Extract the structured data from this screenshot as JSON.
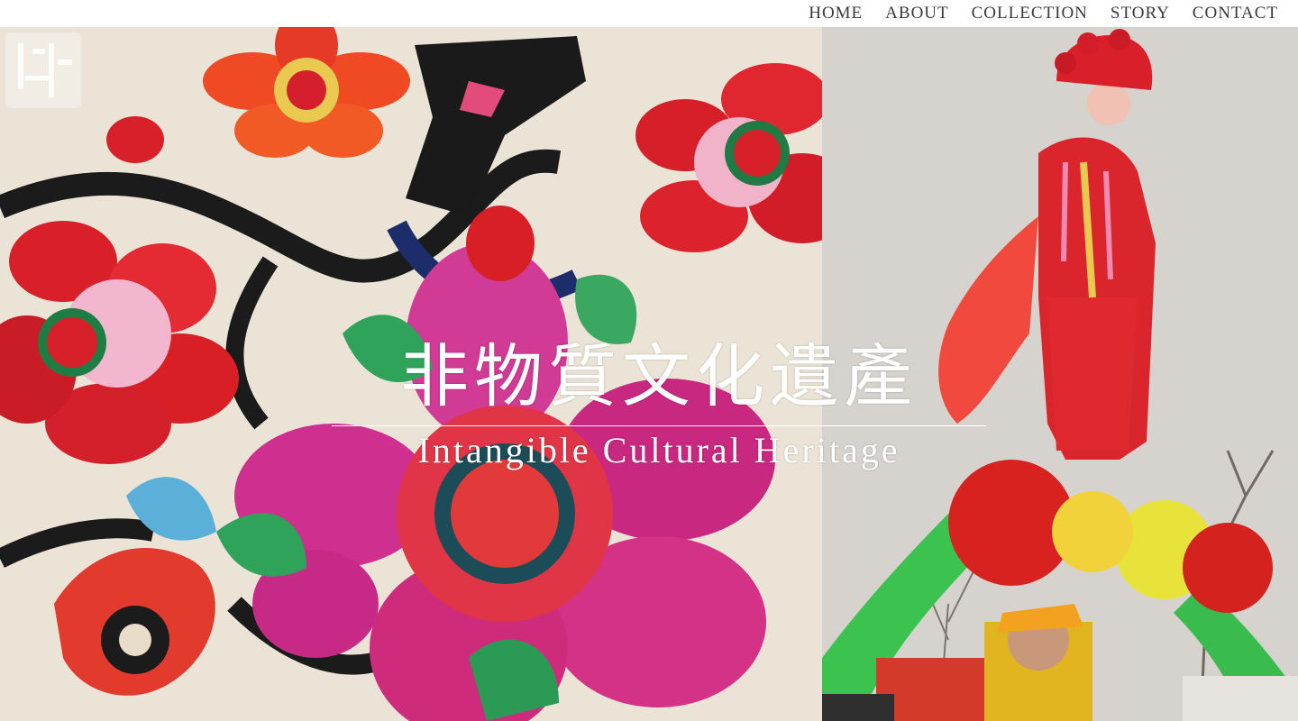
{
  "nav": {
    "items": [
      "HOME",
      "ABOUT",
      "COLLECTION",
      "STORY",
      "CONTACT"
    ]
  },
  "hero": {
    "title_cn": "非物質文化遺產",
    "title_en": "Intangible Cultural Heritage",
    "left_image": "embroidered-flower-textile-photo",
    "right_image": "costumed-stilt-performer-photo"
  },
  "colors": {
    "nav_text": "#3a3a3a",
    "title_text": "#ffffff",
    "magenta": "#d4267f",
    "red": "#d91f26",
    "green": "#2fa35a"
  }
}
